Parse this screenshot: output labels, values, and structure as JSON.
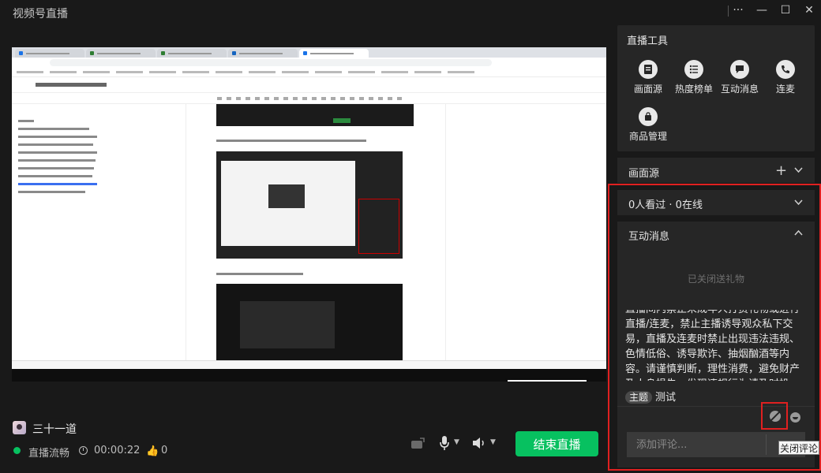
{
  "app": {
    "title": "视频号直播"
  },
  "window_controls": {
    "more": "···",
    "minimize": "—",
    "maximize": "☐",
    "close": "✕"
  },
  "tools": {
    "title": "直播工具",
    "items": [
      {
        "label": "画面源",
        "icon": "screen-source-icon"
      },
      {
        "label": "热度榜单",
        "icon": "ranking-list-icon"
      },
      {
        "label": "互动消息",
        "icon": "message-icon"
      },
      {
        "label": "连麦",
        "icon": "phone-connect-icon"
      },
      {
        "label": "商品管理",
        "icon": "shopping-bag-icon"
      }
    ]
  },
  "source_section": {
    "title": "画面源",
    "add": "+"
  },
  "viewers": {
    "text": "0人看过 · 0在线"
  },
  "interaction": {
    "title": "互动消息",
    "gift_closed": "已关闭送礼物",
    "notice": "直播间内禁止未成年人打赏礼物或进行直播/连麦，禁止主播诱导观众私下交易，直播及连麦时禁止出现违法违规、色情低俗、诱导欺诈、抽烟酗酒等内容。请谨慎判断，理性消费，避免财产及人身损失，发现违规行为请及时投诉。",
    "topic_tag": "主题",
    "topic": "测试",
    "comment_placeholder": "添加评论...",
    "tooltip": "关闭评论"
  },
  "streamer": {
    "name": "三十一道",
    "status": "直播流畅",
    "duration": "00:00:22",
    "likes": "0"
  },
  "controls": {
    "end_live": "结束直播"
  },
  "colors": {
    "accent_green": "#07c160",
    "highlight_red": "#e02020",
    "panel_bg": "#262626",
    "app_bg": "#191919"
  }
}
